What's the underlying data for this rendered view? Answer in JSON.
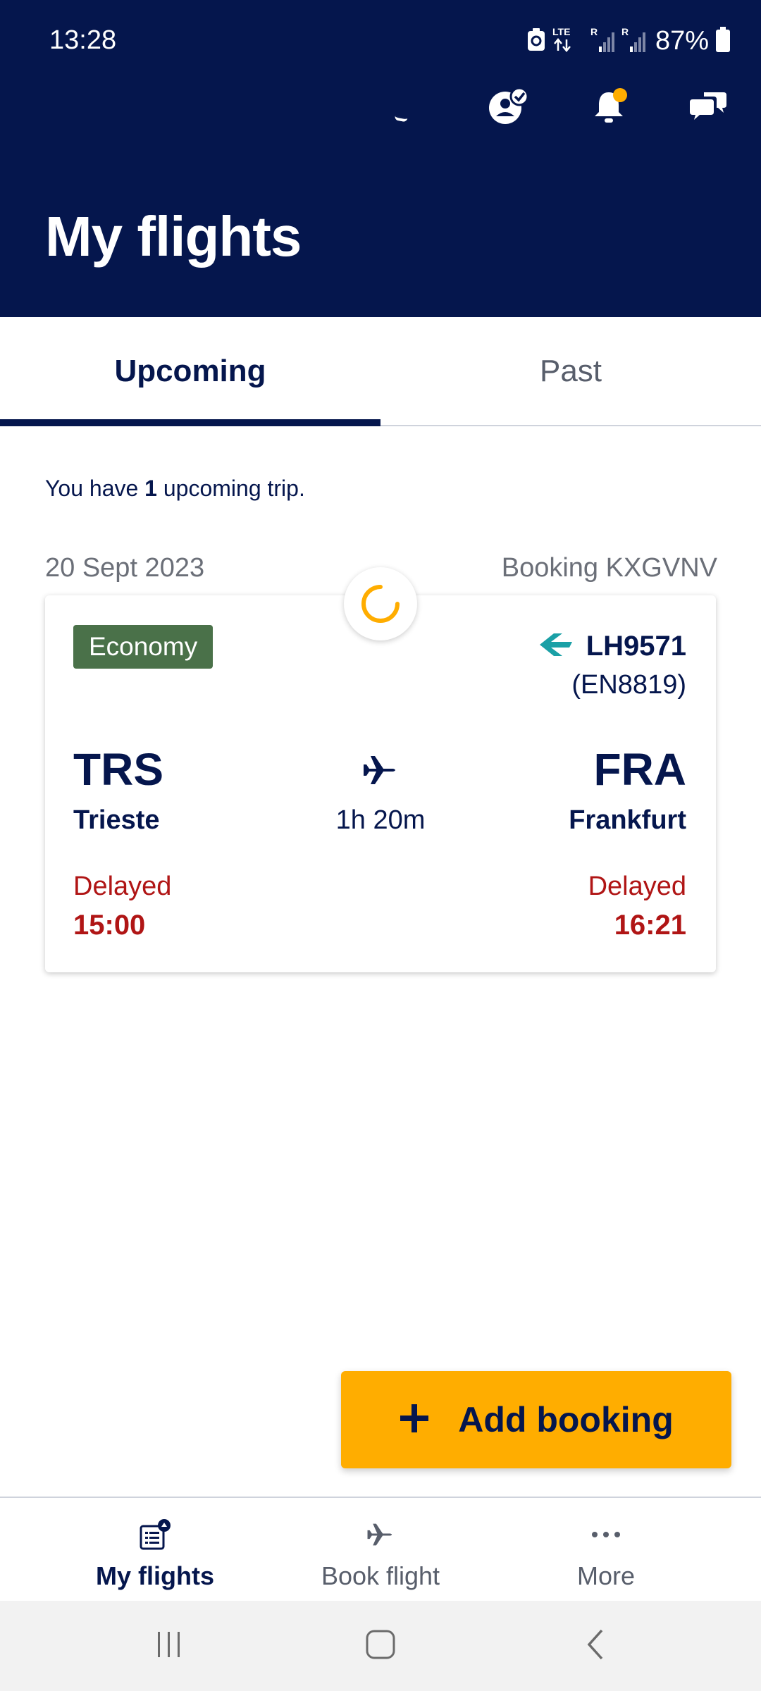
{
  "status_bar": {
    "time": "13:28",
    "network_label": "LTE",
    "roaming_label": "R",
    "battery": "87%"
  },
  "header": {
    "title": "My flights",
    "actions": [
      "profile-icon",
      "notifications-icon",
      "chat-icon"
    ],
    "notification_dot_color": "#ffad00"
  },
  "tabs": {
    "upcoming": "Upcoming",
    "past": "Past",
    "active": "upcoming"
  },
  "summary": {
    "prefix": "You have ",
    "count": "1",
    "suffix": " upcoming trip."
  },
  "trip": {
    "date": "20 Sept 2023",
    "booking": "Booking KXGVNV",
    "cabin_class": "Economy",
    "flight_number": "LH9571",
    "codeshare": "(EN8819)",
    "origin": {
      "code": "TRS",
      "city": "Trieste",
      "status": "Delayed",
      "time": "15:00"
    },
    "destination": {
      "code": "FRA",
      "city": "Frankfurt",
      "status": "Delayed",
      "time": "16:21"
    },
    "duration": "1h 20m"
  },
  "add_booking": {
    "label": "Add booking"
  },
  "bottom_nav": {
    "my_flights": "My flights",
    "book_flight": "Book flight",
    "more": "More"
  },
  "colors": {
    "navy": "#05164d",
    "accent": "#ffad00",
    "delayed": "#b01515",
    "economy_badge": "#4a7149",
    "airline_logo": "#1aa0a6"
  }
}
